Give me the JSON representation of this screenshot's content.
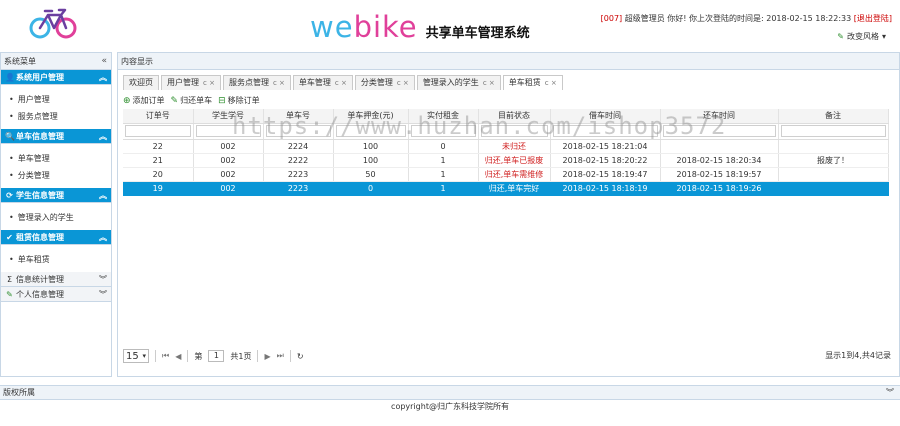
{
  "header": {
    "brand_en_w": "we",
    "brand_en_bike": "bike",
    "brand_cn": "共享单车管理系统",
    "welcome_uid": "[007]",
    "welcome_text": " 超级管理员 你好! 你上次登陆的时间是: 2018-02-15 18:22:33 ",
    "logout": "[退出登陆]",
    "style_switch": "改变风格"
  },
  "left": {
    "title": "系统菜单",
    "groups": [
      {
        "label": "系统用户管理",
        "icon": "user-icon",
        "open": true,
        "items": [
          "用户管理",
          "服务点管理"
        ]
      },
      {
        "label": "单车信息管理",
        "icon": "search-icon",
        "open": true,
        "items": [
          "单车管理",
          "分类管理"
        ]
      },
      {
        "label": "学生信息管理",
        "icon": "refresh-icon",
        "open": true,
        "items": [
          "管理录入的学生"
        ]
      },
      {
        "label": "租赁信息管理",
        "icon": "check-icon",
        "open": true,
        "items": [
          "单车租赁"
        ]
      },
      {
        "label": "信息统计管理",
        "icon": "sigma-icon",
        "open": false,
        "items": []
      },
      {
        "label": "个人信息管理",
        "icon": "pencil-icon",
        "open": false,
        "items": []
      }
    ]
  },
  "main": {
    "title": "内容显示",
    "tabs": [
      {
        "label": "欢迎页",
        "active": false,
        "closable": false
      },
      {
        "label": "用户管理",
        "active": false,
        "closable": true
      },
      {
        "label": "服务点管理",
        "active": false,
        "closable": true
      },
      {
        "label": "单车管理",
        "active": false,
        "closable": true
      },
      {
        "label": "分类管理",
        "active": false,
        "closable": true
      },
      {
        "label": "管理录入的学生",
        "active": false,
        "closable": true
      },
      {
        "label": "单车租赁",
        "active": true,
        "closable": true
      }
    ],
    "toolbar": {
      "add": "添加订单",
      "return": "归还单车",
      "remove": "移除订单"
    },
    "table": {
      "columns": [
        "订单号",
        "学生学号",
        "单车号",
        "单车押金(元)",
        "实付租金",
        "目前状态",
        "借车时间",
        "还车时间",
        "备注"
      ],
      "rows": [
        {
          "id": "22",
          "student": "002",
          "bike": "2224",
          "deposit": "100",
          "rent": "0",
          "status": "未归还",
          "status_color": "red",
          "borrow": "2018-02-15 18:21:04",
          "return": "",
          "note": "",
          "selected": false
        },
        {
          "id": "21",
          "student": "002",
          "bike": "2222",
          "deposit": "100",
          "rent": "1",
          "status": "归还,单车已报废",
          "status_color": "red",
          "borrow": "2018-02-15 18:20:22",
          "return": "2018-02-15 18:20:34",
          "note": "报废了！",
          "selected": false
        },
        {
          "id": "20",
          "student": "002",
          "bike": "2223",
          "deposit": "50",
          "rent": "1",
          "status": "归还,单车需维修",
          "status_color": "red",
          "borrow": "2018-02-15 18:19:47",
          "return": "2018-02-15 18:19:57",
          "note": "",
          "selected": false
        },
        {
          "id": "19",
          "student": "002",
          "bike": "2223",
          "deposit": "0",
          "rent": "1",
          "status": "归还,单车完好",
          "status_color": "green",
          "borrow": "2018-02-15 18:18:19",
          "return": "2018-02-15 18:19:26",
          "note": "",
          "selected": true
        }
      ]
    },
    "pager": {
      "page_size": "15",
      "page_prefix": "第",
      "page_value": "1",
      "page_total": "共1页",
      "info": "显示1到4,共4记录"
    }
  },
  "footer": {
    "bar": "版权所属",
    "copyright": "copyright@归广东科技学院所有"
  },
  "watermark": "https://www.huzhan.com/ishop3572",
  "colors": {
    "accent": "#0a96d6",
    "brand_blue": "#3cb4e6",
    "brand_pink": "#e0409a",
    "danger": "#d02020",
    "ok": "#2f8f2f"
  }
}
